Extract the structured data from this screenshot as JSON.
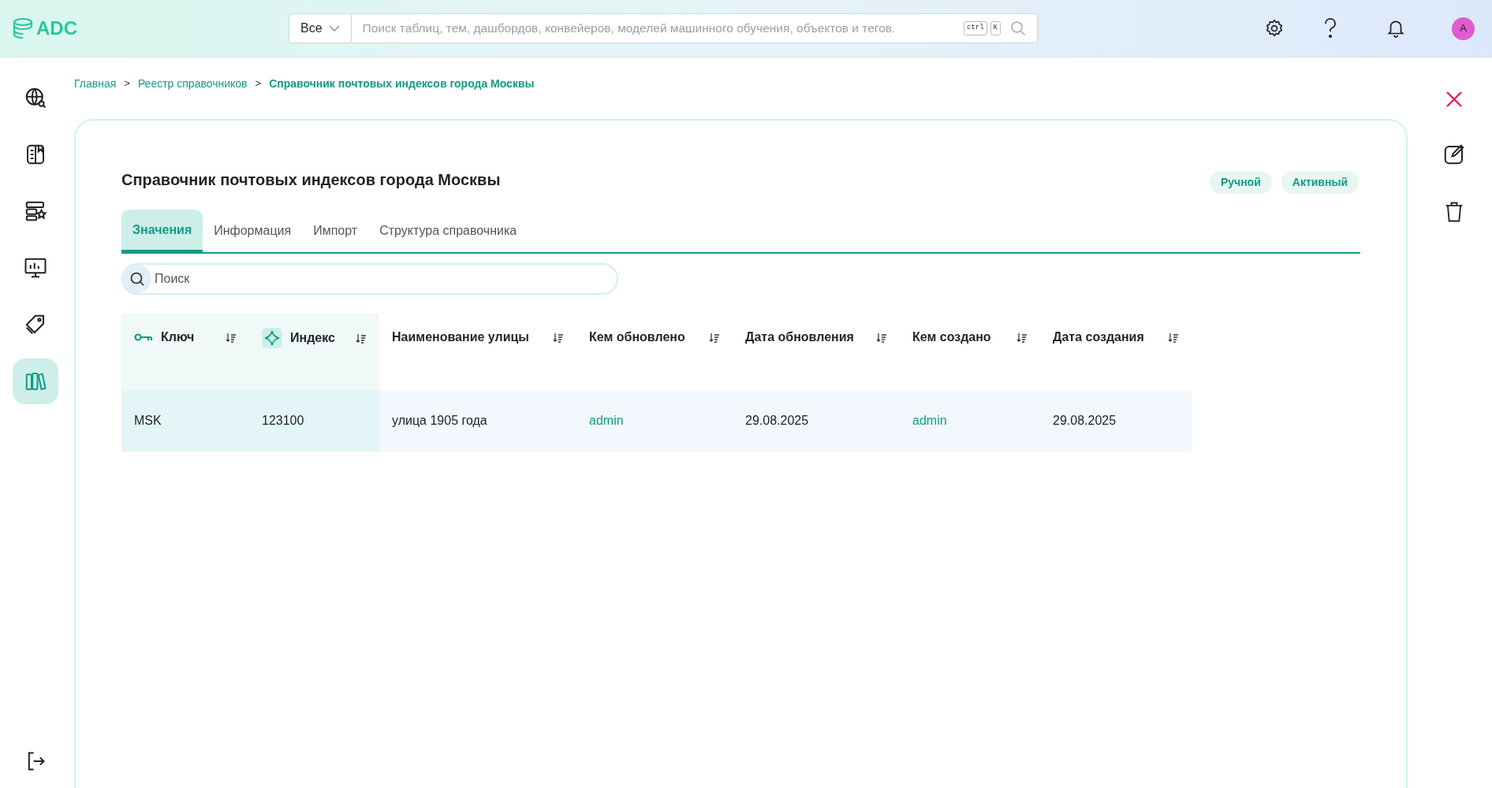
{
  "header": {
    "logo": "ADC",
    "search_scope": "Все",
    "search_placeholder": "Поиск таблиц, тем, дашбордов, конвейеров, моделей машинного обучения, объектов и тегов.",
    "shortcut_keys": [
      "ctrl",
      "K"
    ],
    "avatar": "A"
  },
  "sidebar": {
    "items": [
      {
        "kind": "globe",
        "selected": false
      },
      {
        "kind": "book",
        "selected": false
      },
      {
        "kind": "servers",
        "selected": false
      },
      {
        "kind": "monitor",
        "selected": false
      },
      {
        "kind": "tag",
        "selected": false
      },
      {
        "kind": "library",
        "selected": true
      }
    ]
  },
  "breadcrumb_separator": ">",
  "breadcrumbs": [
    {
      "label": "Главная",
      "current": false
    },
    {
      "label": "Реестр справочников",
      "current": false
    },
    {
      "label": "Справочник почтовых индексов города Москвы",
      "current": true
    }
  ],
  "title": "Справочник почтовых индексов города Москвы",
  "badges": [
    "Ручной",
    "Активный"
  ],
  "tabs": [
    {
      "label": "Значения",
      "selected": true
    },
    {
      "label": "Информация",
      "selected": false
    },
    {
      "label": "Импорт",
      "selected": false
    },
    {
      "label": "Структура справочника",
      "selected": false
    }
  ],
  "search": {
    "placeholder": "Поиск"
  },
  "table": {
    "columns": [
      {
        "label": "Ключ",
        "kind": "key"
      },
      {
        "label": "Индекс",
        "kind": "index"
      },
      {
        "label": "Наименование улицы",
        "kind": "plain"
      },
      {
        "label": "Кем обновлено",
        "kind": "plain"
      },
      {
        "label": "Дата обновления",
        "kind": "plain"
      },
      {
        "label": "Кем создано",
        "kind": "plain"
      },
      {
        "label": "Дата создания",
        "kind": "plain"
      }
    ],
    "rows": [
      {
        "cells": [
          {
            "text": "MSK",
            "kind": "plain"
          },
          {
            "text": "123100",
            "kind": "plain"
          },
          {
            "text": "улица 1905 года",
            "kind": "plain"
          },
          {
            "text": "admin",
            "kind": "link"
          },
          {
            "text": "29.08.2025",
            "kind": "plain"
          },
          {
            "text": "admin",
            "kind": "link"
          },
          {
            "text": "29.08.2025",
            "kind": "plain"
          }
        ]
      }
    ]
  }
}
